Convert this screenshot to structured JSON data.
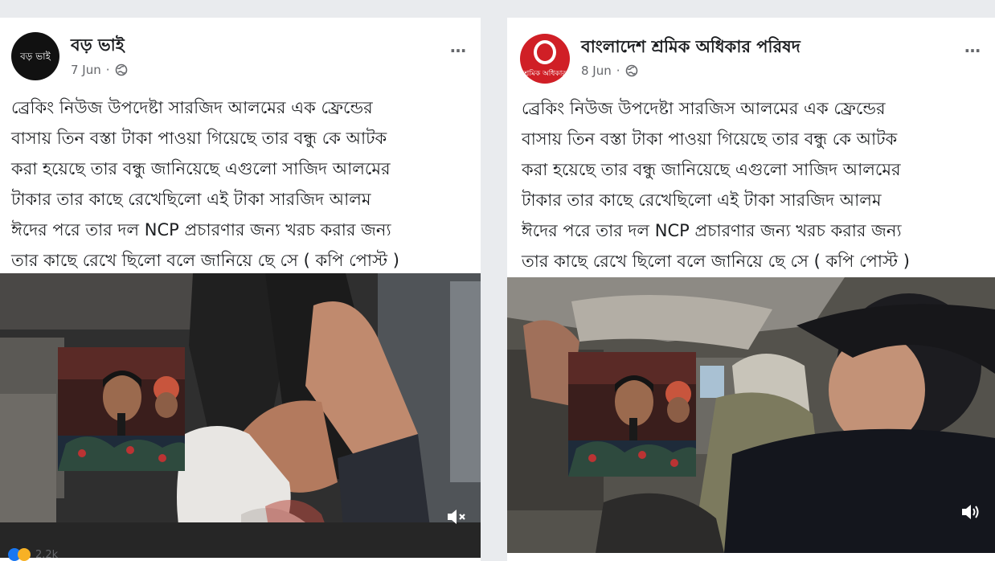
{
  "posts": [
    {
      "page_name": "বড় ভাই",
      "avatar_text": "বড় ভাই",
      "date": "7 Jun",
      "lines": [
        "ব্রেকিং নিউজ উপদেষ্টা সারজিদ আলমের এক ফ্রেন্ডের",
        "বাসায় তিন বস্তা টাকা পাওয়া গিয়েছে তার বন্ধু কে আটক",
        "করা হয়েছে তার বন্ধু জানিয়েছে এগুলো সাজিদ আলমের",
        "টাকার তার কাছে রেখেছিলো এই টাকা সারজিদ আলম",
        "ঈদের  পরে তার দল NCP প্রচারণার জন্য খরচ করার জন্য",
        "তার কাছে রেখে ছিলো বলে জানিয়ে ছে সে  ( কপি পোস্ট )"
      ],
      "video_sound": "muted",
      "footer_text": "2.2k"
    },
    {
      "page_name": "বাংলাদেশ শ্রমিক অধিকার পরিষদ",
      "avatar_text": "শ্রমিক অধিকার",
      "date": "8 Jun",
      "lines": [
        "ব্রেকিং নিউজ উপদেষ্টা সারজিস আলমের এক ফ্রেন্ডের",
        "বাসায় তিন বস্তা টাকা পাওয়া গিয়েছে তার বন্ধু কে আটক",
        "করা হয়েছে তার বন্ধু জানিয়েছে এগুলো সাজিদ আলমের",
        "টাকার তার কাছে রেখেছিলো এই টাকা সারজিদ আলম",
        "ঈদের  পরে তার দল NCP প্রচারণার জন্য খরচ করার জন্য",
        "তার কাছে রেখে ছিলো বলে জানিয়ে ছে সে  ( কপি পোস্ট )"
      ],
      "video_sound": "on"
    }
  ],
  "more_icon": "…",
  "colors": {
    "text": "#1c1e21",
    "meta": "#65676b",
    "avatar2": "#d01f26",
    "like": "#1877f2"
  }
}
